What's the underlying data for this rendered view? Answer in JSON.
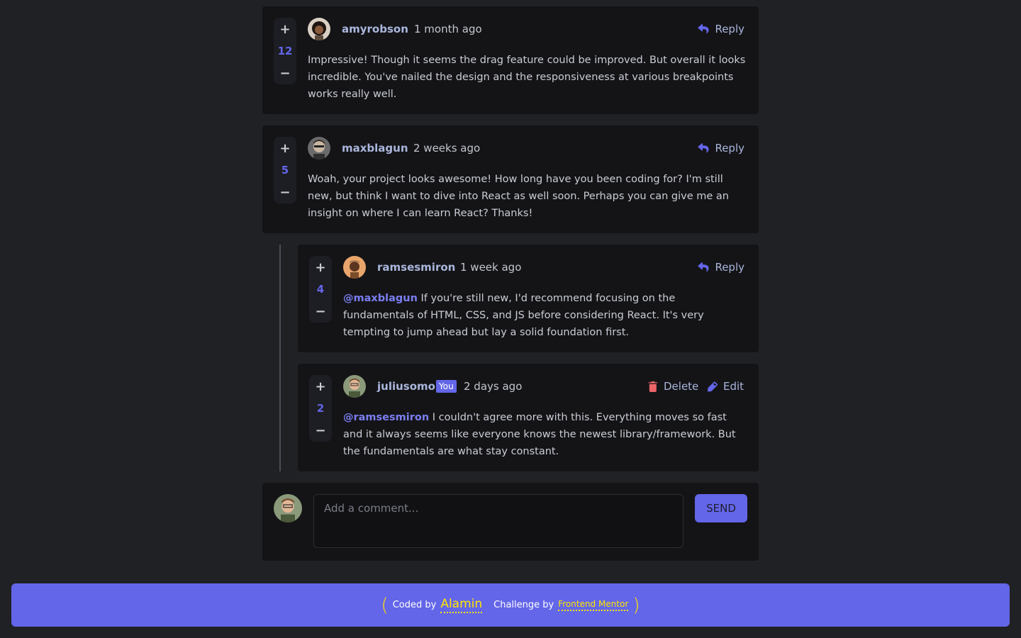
{
  "comments": [
    {
      "score": "12",
      "username": "amyrobson",
      "time": "1 month ago",
      "reply_label": "Reply",
      "mention": "",
      "text": "Impressive! Though it seems the drag feature could be improved. But overall it looks incredible. You've nailed the design and the responsiveness at various breakpoints works really well."
    },
    {
      "score": "5",
      "username": "maxblagun",
      "time": "2 weeks ago",
      "reply_label": "Reply",
      "mention": "",
      "text": "Woah, your project looks awesome! How long have you been coding for? I'm still new, but think I want to dive into React as well soon. Perhaps you can give me an insight on where I can learn React? Thanks!"
    }
  ],
  "replies": [
    {
      "score": "4",
      "username": "ramsesmiron",
      "time": "1 week ago",
      "reply_label": "Reply",
      "mention": "@maxblagun",
      "text": "If you're still new, I'd recommend focusing on the fundamentals of HTML, CSS, and JS before considering React. It's very tempting to jump ahead but lay a solid foundation first."
    },
    {
      "score": "2",
      "username": "juliusomo",
      "you_badge": "You",
      "time": "2 days ago",
      "delete_label": "Delete",
      "edit_label": "Edit",
      "mention": "@ramsesmiron",
      "text": "I couldn't agree more with this. Everything moves so fast and it always seems like everyone knows the newest library/framework. But the fundamentals are what stay constant."
    }
  ],
  "vote": {
    "plus": "+",
    "minus": "−"
  },
  "compose": {
    "placeholder": "Add a comment...",
    "send_label": "SEND"
  },
  "footer": {
    "open_paren": "(",
    "coded_by": "Coded by",
    "author": "Alamin",
    "challenge_by": "Challenge by",
    "challenge_link": "Frontend Mentor",
    "close_paren": ")"
  },
  "colors": {
    "background": "#202125",
    "card": "#141417",
    "accent": "#6366e8",
    "delete": "#ed6468",
    "footer_link": "#ffe600"
  },
  "icons": [
    "reply-icon",
    "delete-icon",
    "edit-icon"
  ]
}
